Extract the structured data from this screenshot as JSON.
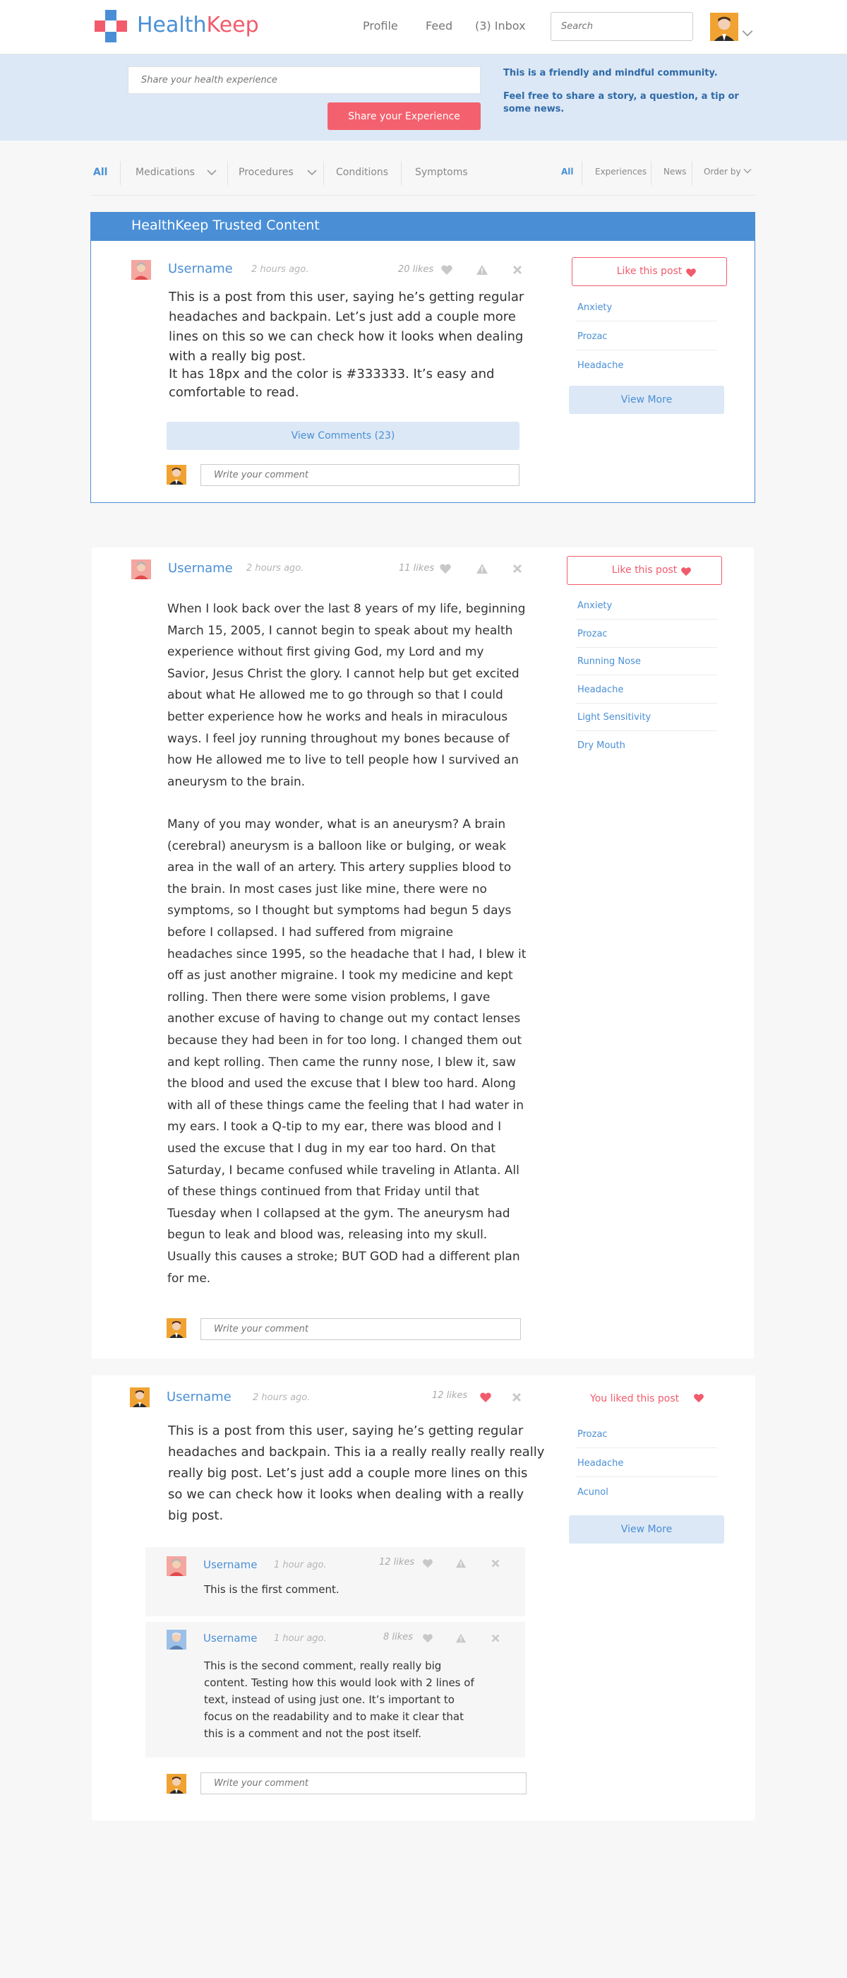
{
  "brand": {
    "name_part1": "Health",
    "name_part2": "Keep"
  },
  "nav": {
    "profile": "Profile",
    "feed": "Feed",
    "inbox": "(3) Inbox"
  },
  "search": {
    "placeholder": "Search"
  },
  "share": {
    "placeholder": "Share your health experience",
    "button": "Share your Experience",
    "note1": "This is a friendly and mindful community.",
    "note2_line1": "Feel free to share a story, a question, a tip or",
    "note2_line2": "some news."
  },
  "filters": {
    "left": {
      "all": "All",
      "medications": "Medications",
      "procedures": "Procedures",
      "conditions": "Conditions",
      "symptoms": "Symptoms"
    },
    "right": {
      "all": "All",
      "experiences": "Experiences",
      "news": "News",
      "order_by": "Order by"
    }
  },
  "trusted": {
    "title": "HealthKeep Trusted Content",
    "post": {
      "username": "Username",
      "time": "2 hours ago.",
      "likes": "20 likes",
      "lines": [
        "This is a post from this user, saying he’s getting regular",
        "headaches and backpain. Let’s just add a couple more",
        "lines on this so we can check how it looks when dealing",
        "with a really big post.",
        "It has 18px and the color is #333333. It’s easy and",
        "comfortable to read."
      ],
      "view_comments": "View Comments (23)",
      "comment_placeholder": "Write your comment",
      "like_label": "Like this post",
      "tags": [
        "Anxiety",
        "Prozac",
        "Headache"
      ],
      "view_more": "View More"
    }
  },
  "post2": {
    "username": "Username",
    "time": "2 hours ago.",
    "likes": "11 likes",
    "para1": [
      "When I look back over the last 8 years of my life, beginning",
      "March 15, 2005, I cannot begin to speak about my health",
      "experience without first giving God, my Lord and my",
      "Savior, Jesus Christ the glory. I cannot help but get excited",
      "about what He allowed me to go through so that I could",
      "better experience how he works and heals in miraculous",
      "ways. I feel joy running throughout my bones because of",
      "how He allowed me to live to tell people how I survived an",
      "aneurysm to the brain."
    ],
    "para2": [
      "Many of you may wonder, what is an aneurysm? A brain",
      "(cerebral) aneurysm is a balloon like or bulging, or weak",
      "area in the wall of an artery. This artery supplies blood to",
      "the brain. In most cases just like mine, there were no",
      "symptoms, so I thought but symptoms had begun 5 days",
      "before I collapsed. I had suffered from migraine",
      "headaches since 1995, so the headache that I had, I blew it",
      "off as just another migraine. I took my medicine and kept",
      "rolling. Then there were some vision problems, I gave",
      "another excuse of having to change out my contact lenses",
      "because they had been in for too long. I changed them out",
      "and kept rolling. Then came the runny nose, I blew it, saw",
      "the blood and used the excuse that I blew too hard. Along",
      "with all of these things came the feeling that I had water in",
      "my ears. I took a Q-tip to my ear, there was blood and I",
      "used the excuse that I dug in my ear too hard. On that",
      "Saturday, I became confused while traveling in Atlanta. All",
      "of these things continued from that Friday until that",
      "Tuesday when I collapsed at the gym. The aneurysm had",
      "begun to leak and blood was, releasing into my skull.",
      "Usually this causes a stroke; BUT GOD had a different plan",
      "for me."
    ],
    "comment_placeholder": "Write your comment",
    "like_label": "Like this post",
    "tags": [
      "Anxiety",
      "Prozac",
      "Running Nose",
      "Headache",
      "Light Sensitivity",
      "Dry Mouth"
    ]
  },
  "post3": {
    "username": "Username",
    "time": "2 hours ago.",
    "likes": "12 likes",
    "lines": [
      "This is a post from this user, saying he’s getting regular",
      "headaches and backpain. This ia a really really really really",
      "really big post. Let’s just add a couple more lines on this",
      "so we can check how it looks when dealing with a really",
      "big post."
    ],
    "liked_label": "You liked this post",
    "tags": [
      "Prozac",
      "Headache",
      "Acunol"
    ],
    "view_more": "View More",
    "comments": [
      {
        "username": "Username",
        "time": "1 hour ago.",
        "likes": "12 likes",
        "lines": [
          "This is the first comment."
        ]
      },
      {
        "username": "Username",
        "time": "1 hour ago.",
        "likes": "8 likes",
        "lines": [
          "This is the second comment, really really big",
          "content. Testing how this would look with 2 lines of",
          "text, instead of using just one. It’s important to",
          "focus on the readability and to make it clear that",
          "this is a comment and not the post itself."
        ]
      }
    ],
    "comment_placeholder": "Write your comment"
  },
  "colors": {
    "brand_blue": "#4a8fd6",
    "brand_red": "#f15b6c",
    "band_blue": "#dce8f5",
    "text": "#333333"
  },
  "icons": [
    "logo-cross-icon",
    "heart-icon",
    "flag-icon",
    "close-icon",
    "chevron-down-icon"
  ]
}
